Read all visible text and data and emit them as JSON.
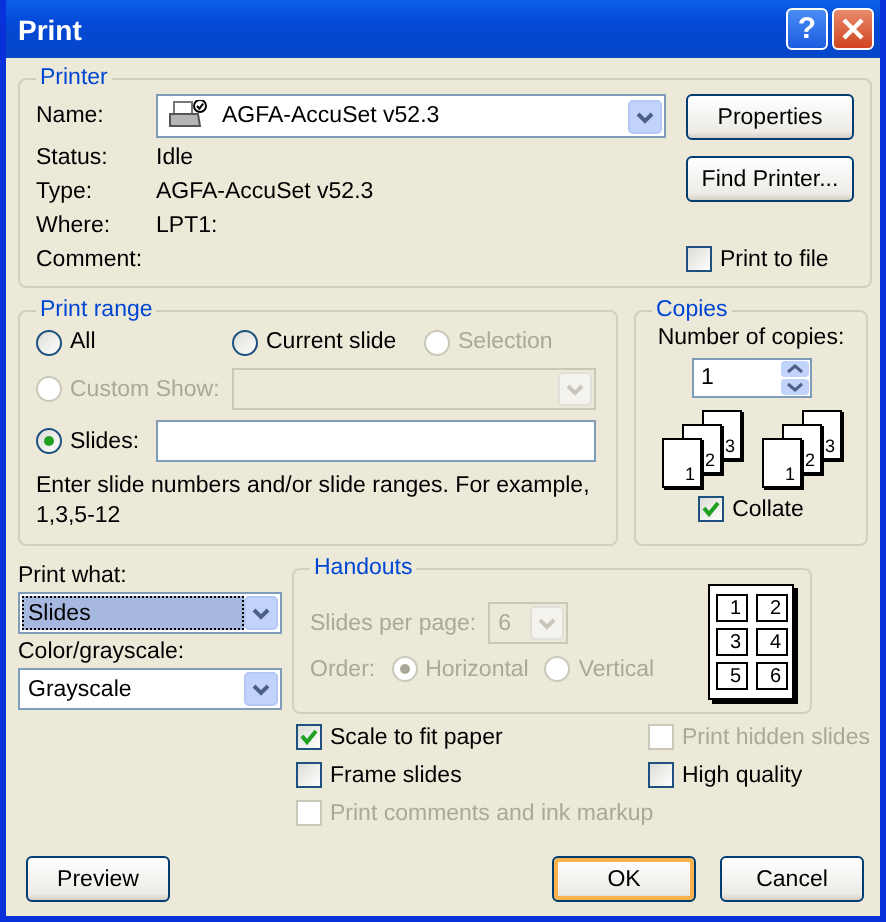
{
  "window": {
    "title": "Print",
    "help_button": "?"
  },
  "printer": {
    "legend": "Printer",
    "name_label": "Name:",
    "name_value": "AGFA-AccuSet v52.3",
    "info": [
      {
        "label": "Status:",
        "value": "Idle"
      },
      {
        "label": "Type:",
        "value": "AGFA-AccuSet v52.3"
      },
      {
        "label": "Where:",
        "value": "LPT1:"
      },
      {
        "label": "Comment:"
      }
    ],
    "buttons": [
      "Properties",
      "Find Printer..."
    ],
    "print_to_file": {
      "label": "Print to file",
      "checked": false
    }
  },
  "print_range": {
    "legend": "Print range",
    "options": [
      {
        "label": "All",
        "selected": false,
        "disabled": false
      },
      {
        "label": "Current slide",
        "selected": false,
        "disabled": false
      },
      {
        "label": "Selection",
        "selected": false,
        "disabled": true
      },
      {
        "label": "Custom Show:",
        "selected": false,
        "disabled": true
      },
      {
        "label": "Slides:",
        "selected": true,
        "disabled": false
      }
    ],
    "hint": "Enter slide numbers and/or slide ranges. For example, 1,3,5-12"
  },
  "copies": {
    "legend": "Copies",
    "label": "Number of copies:",
    "value": "1",
    "stacks": [
      [
        "1",
        "2",
        "3"
      ],
      [
        "1",
        "2",
        "3"
      ]
    ],
    "collate": {
      "label": "Collate",
      "checked": true
    }
  },
  "print_what": {
    "label": "Print what:",
    "value": "Slides",
    "focused": true
  },
  "color": {
    "label": "Color/grayscale:",
    "value": "Grayscale",
    "focused": false
  },
  "handouts": {
    "legend": "Handouts",
    "disabled": true,
    "per_page_label": "Slides per page:",
    "per_page_value": "6",
    "order_label": "Order:",
    "order": [
      {
        "label": "Horizontal",
        "selected": true
      },
      {
        "label": "Vertical",
        "selected": false
      }
    ],
    "preview": [
      "1",
      "2",
      "3",
      "4",
      "5",
      "6"
    ]
  },
  "options": [
    {
      "label": "Scale to fit paper",
      "checked": true,
      "disabled": false
    },
    {
      "label": "Print hidden slides",
      "checked": false,
      "disabled": true
    },
    {
      "label": "Frame slides",
      "checked": false,
      "disabled": false
    },
    {
      "label": "High quality",
      "checked": false,
      "disabled": false
    },
    {
      "label": "Print comments and ink markup",
      "checked": false,
      "disabled": true
    }
  ],
  "buttons": [
    {
      "label": "Preview",
      "default": false
    },
    {
      "label": "OK",
      "default": true
    },
    {
      "label": "Cancel",
      "default": false
    }
  ]
}
